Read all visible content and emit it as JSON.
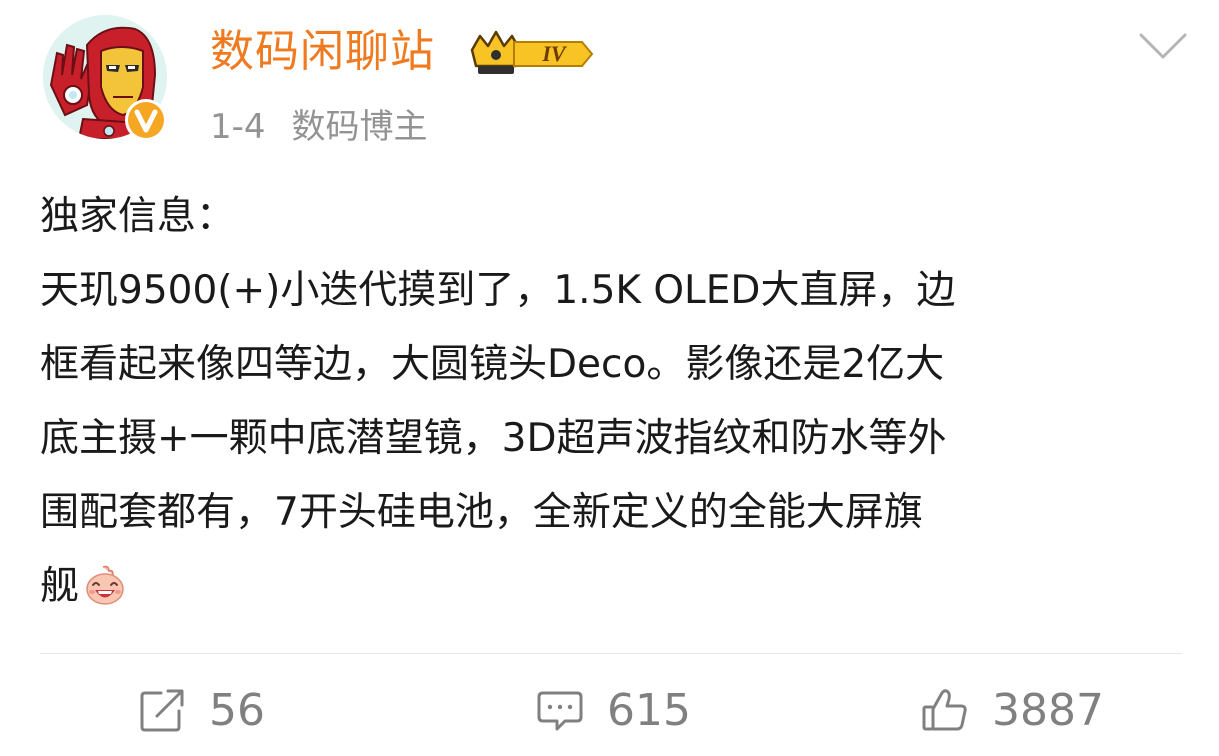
{
  "author": {
    "name": "数码闲聊站",
    "level_badge": "IV",
    "verified": true
  },
  "meta": {
    "time": "1-4",
    "tag": "数码博主"
  },
  "post": {
    "lines": [
      "独家信息：",
      "天玑9500(+)小迭代摸到了，1.5K OLED大直屏，边",
      "框看起来像四等边，大圆镜头Deco。影像还是2亿大",
      "底主摄+一颗中底潜望镜，3D超声波指纹和防水等外",
      "围配套都有，7开头硅电池，全新定义的全能大屏旗",
      "舰"
    ],
    "emoji": "laughing-emoji"
  },
  "actions": {
    "reposts": "56",
    "comments": "615",
    "likes": "3887"
  },
  "colors": {
    "author_name": "#f07a1f",
    "meta_text": "#939393",
    "body_text": "#1a1a1a",
    "action_text": "#808080",
    "divider": "#e6e6e6",
    "verified_badge": "#f5a623"
  }
}
